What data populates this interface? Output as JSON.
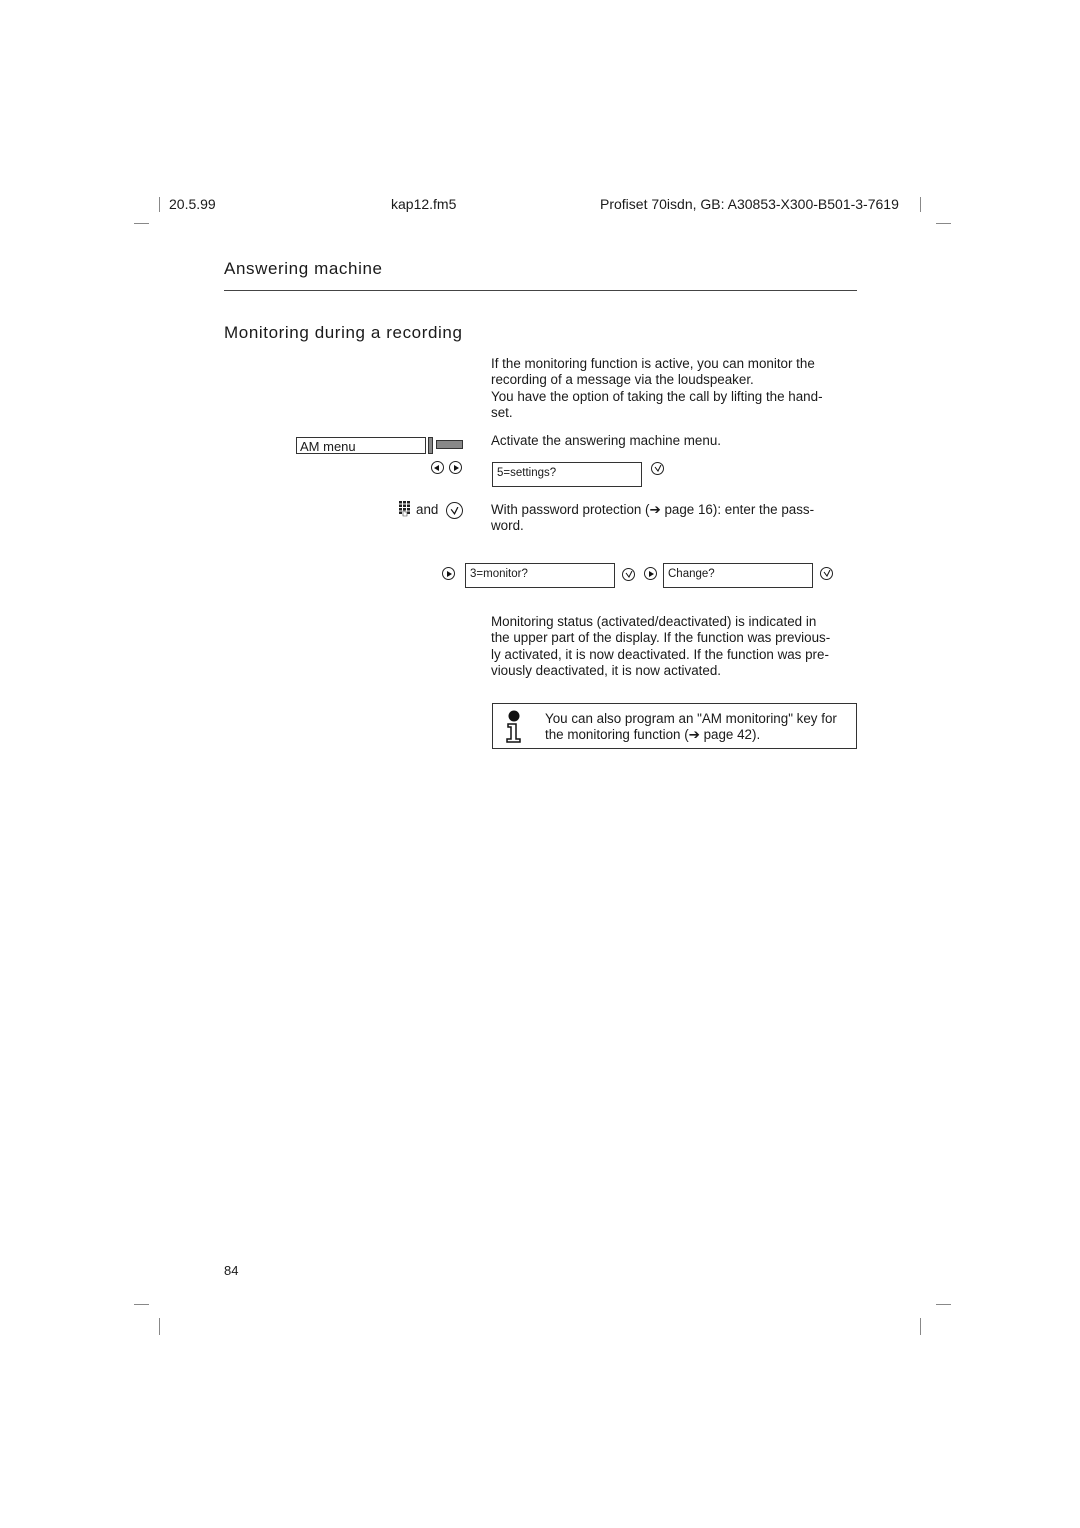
{
  "header": {
    "date": "20.5.99",
    "file": "kap12.fm5",
    "product": "Profiset 70isdn, GB: A30853-X300-B501-3-7619"
  },
  "chapter_title": "Answering machine",
  "section_title": "Monitoring during a recording",
  "intro": {
    "line1": "If the monitoring function is active, you can monitor the",
    "line2": "recording of a message via the loudspeaker.",
    "line3": "You have the option of taking the call by lifting the hand-",
    "line4": "set."
  },
  "steps": {
    "am_menu_key": "AM menu",
    "activate_text": "Activate the answering machine menu.",
    "display_settings": "5=settings?",
    "and_label": "and",
    "password_line1": "With password protection (➔ page 16): enter the pass-",
    "password_line2": "word.",
    "display_monitor": "3=monitor?",
    "display_change": "Change?"
  },
  "status_text": {
    "line1": "Monitoring status (activated/deactivated) is indicated in",
    "line2": "the upper part of the display. If the function was previous-",
    "line3": "ly activated, it is now deactivated. If the function was pre-",
    "line4": "viously deactivated, it is now activated."
  },
  "note": {
    "icon": "info-icon",
    "line1": "You can also program an \"AM monitoring\" key for",
    "line2": "the monitoring function (➔ page 42)."
  },
  "page_number": "84",
  "icons": {
    "nav_left": "left-arrow-circle-icon",
    "nav_right": "right-arrow-circle-icon",
    "confirm": "check-circle-icon",
    "keypad": "keypad-icon",
    "key": "function-key-icon"
  }
}
